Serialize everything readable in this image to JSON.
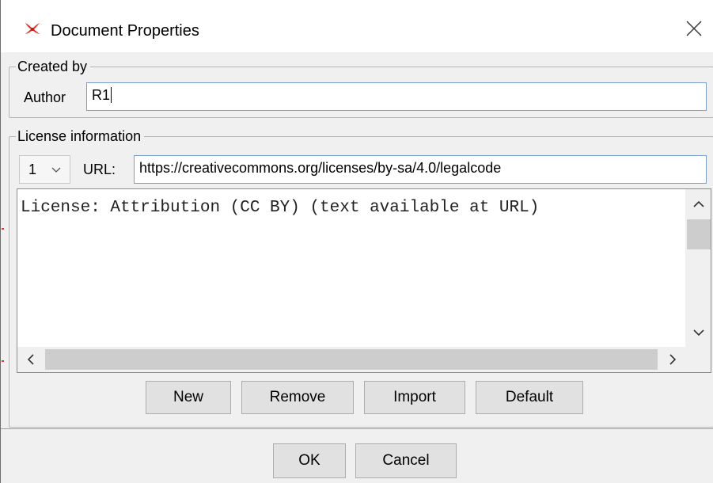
{
  "window": {
    "title": "Document Properties",
    "app_icon": "red-cross-app-icon",
    "close_icon": "close-icon"
  },
  "created_by": {
    "legend": "Created by",
    "author_label": "Author",
    "author_value": "R1"
  },
  "license": {
    "legend": "License information",
    "index_value": "1",
    "url_label": "URL:",
    "url_value": "https://creativecommons.org/licenses/by-sa/4.0/legalcode",
    "text": "License: Attribution (CC BY) (text available at URL)",
    "buttons": {
      "new": "New",
      "remove": "Remove",
      "import": "Import",
      "default": "Default"
    }
  },
  "footer": {
    "ok": "OK",
    "cancel": "Cancel"
  },
  "colors": {
    "accent_border": "#7a9ecb",
    "app_icon_red": "#e0352b"
  }
}
